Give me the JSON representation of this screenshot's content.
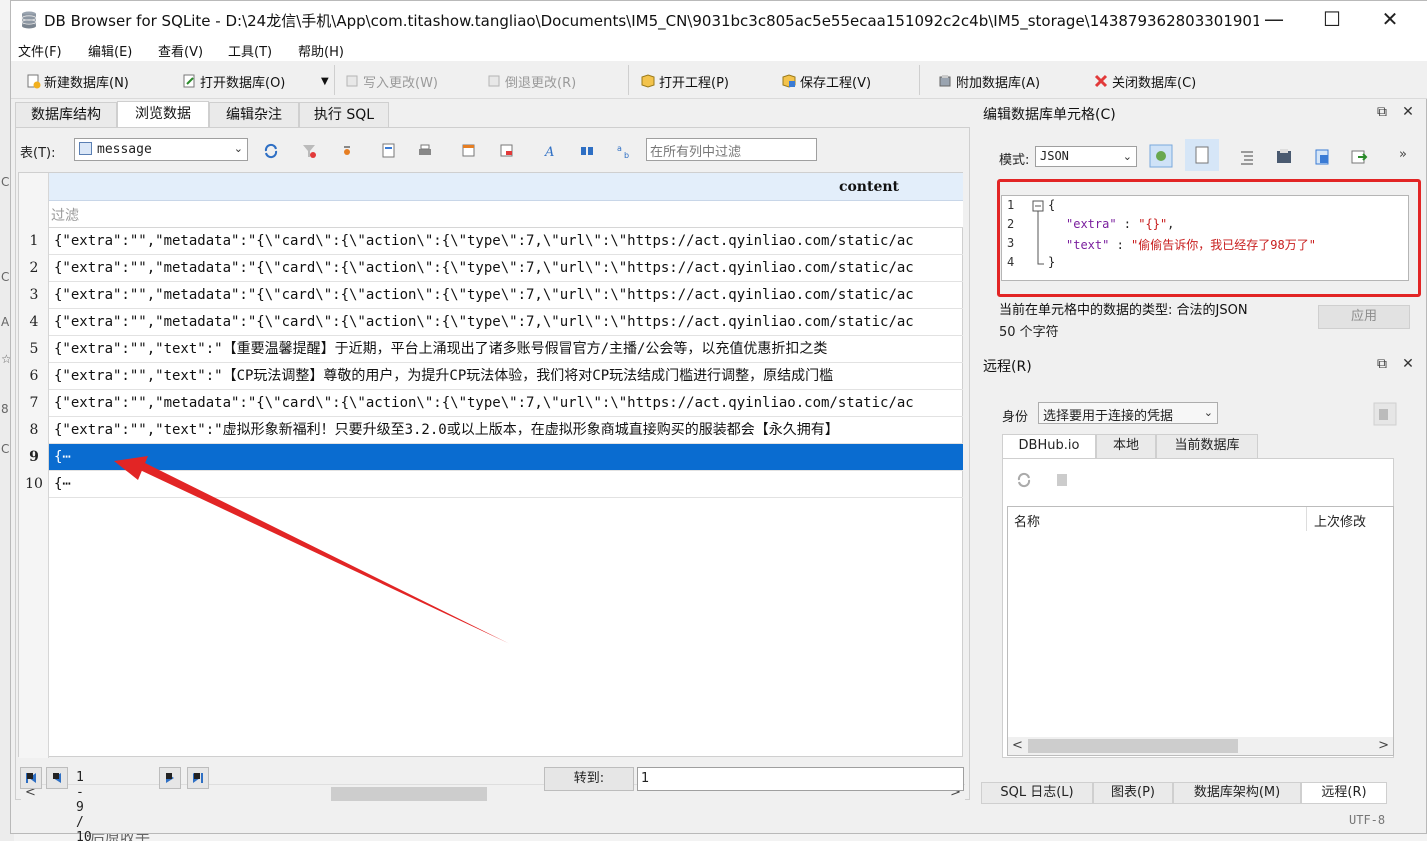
{
  "window": {
    "title": "DB Browser for SQLite - D:\\24龙信\\手机\\App\\com.titashow.tangliao\\Documents\\IM5_CN\\9031bc3c805ac5e55ecaa151092c2c4b\\IM5_storage\\143879362803301901..."
  },
  "menu": [
    "文件(F)",
    "编辑(E)",
    "查看(V)",
    "工具(T)",
    "帮助(H)"
  ],
  "toolbar": {
    "new_db": "新建数据库(N)",
    "open_db": "打开数据库(O)",
    "write_changes": "写入更改(W)",
    "revert_changes": "倒退更改(R)",
    "open_project": "打开工程(P)",
    "save_project": "保存工程(V)",
    "attach_db": "附加数据库(A)",
    "close_db": "关闭数据库(C)"
  },
  "main_tabs": [
    "数据库结构",
    "浏览数据",
    "编辑杂注",
    "执行 SQL"
  ],
  "browse": {
    "table_label": "表(T):",
    "table_value": "message",
    "filter_all_placeholder": "在所有列中过滤",
    "column_header": "content",
    "filter_placeholder": "过滤",
    "rows": [
      {
        "num": "1",
        "content": "{\"extra\":\"\",\"metadata\":\"{\\\"card\\\":{\\\"action\\\":{\\\"type\\\":7,\\\"url\\\":\\\"https://act.qyinliao.com/static/ac"
      },
      {
        "num": "2",
        "content": "{\"extra\":\"\",\"metadata\":\"{\\\"card\\\":{\\\"action\\\":{\\\"type\\\":7,\\\"url\\\":\\\"https://act.qyinliao.com/static/ac"
      },
      {
        "num": "3",
        "content": "{\"extra\":\"\",\"metadata\":\"{\\\"card\\\":{\\\"action\\\":{\\\"type\\\":7,\\\"url\\\":\\\"https://act.qyinliao.com/static/ac"
      },
      {
        "num": "4",
        "content": "{\"extra\":\"\",\"metadata\":\"{\\\"card\\\":{\\\"action\\\":{\\\"type\\\":7,\\\"url\\\":\\\"https://act.qyinliao.com/static/ac"
      },
      {
        "num": "5",
        "content": "{\"extra\":\"\",\"text\":\"【重要温馨提醒】于近期，平台上涌现出了诸多账号假冒官方/主播/公会等，以充值优惠折扣之类"
      },
      {
        "num": "6",
        "content": "{\"extra\":\"\",\"text\":\"【CP玩法调整】尊敬的用户，为提升CP玩法体验，我们将对CP玩法结成门槛进行调整，原结成门槛"
      },
      {
        "num": "7",
        "content": "{\"extra\":\"\",\"metadata\":\"{\\\"card\\\":{\\\"action\\\":{\\\"type\\\":7,\\\"url\\\":\\\"https://act.qyinliao.com/static/ac"
      },
      {
        "num": "8",
        "content": "{\"extra\":\"\",\"text\":\"虚拟形象新福利！只要升级至3.2.0或以上版本，在虚拟形象商城直接购买的服装都会【永久拥有】"
      },
      {
        "num": "9",
        "content": "{⋯"
      },
      {
        "num": "10",
        "content": "{⋯"
      }
    ],
    "selected_row": "9",
    "record_count": "1 - 9 / 10",
    "goto_label": "转到:",
    "goto_value": "1"
  },
  "edit_cell": {
    "title": "编辑数据库单元格(C)",
    "mode_label": "模式:",
    "mode_value": "JSON",
    "lines": [
      "1",
      "2",
      "3",
      "4"
    ],
    "json_open": "{",
    "json_close": "}",
    "json_key1": "\"extra\"",
    "json_sep1": " : ",
    "json_val1": "\"{}\"",
    "json_comma": ",",
    "json_key2": "\"text\"",
    "json_sep2": " : ",
    "json_val2": "\"偷偷告诉你，我已经存了98万了\"",
    "type_text": "当前在单元格中的数据的类型: 合法的JSON",
    "chars_text": "50 个字符",
    "apply_label": "应用"
  },
  "remote": {
    "title": "远程(R)",
    "identity_label": "身份",
    "identity_value": "选择要用于连接的凭据",
    "tabs": [
      "DBHub.io",
      "本地",
      "当前数据库"
    ],
    "col_name": "名称",
    "col_modified": "上次修改"
  },
  "bottom_tabs": [
    "SQL 日志(L)",
    "图表(P)",
    "数据库架构(M)",
    "远程(R)"
  ],
  "status": {
    "encoding": "UTF-8"
  },
  "backdrop": {
    "bottom_text": "后原收手"
  },
  "colors": {
    "selection": "#0a6cd0",
    "annotation": "#e22525"
  }
}
